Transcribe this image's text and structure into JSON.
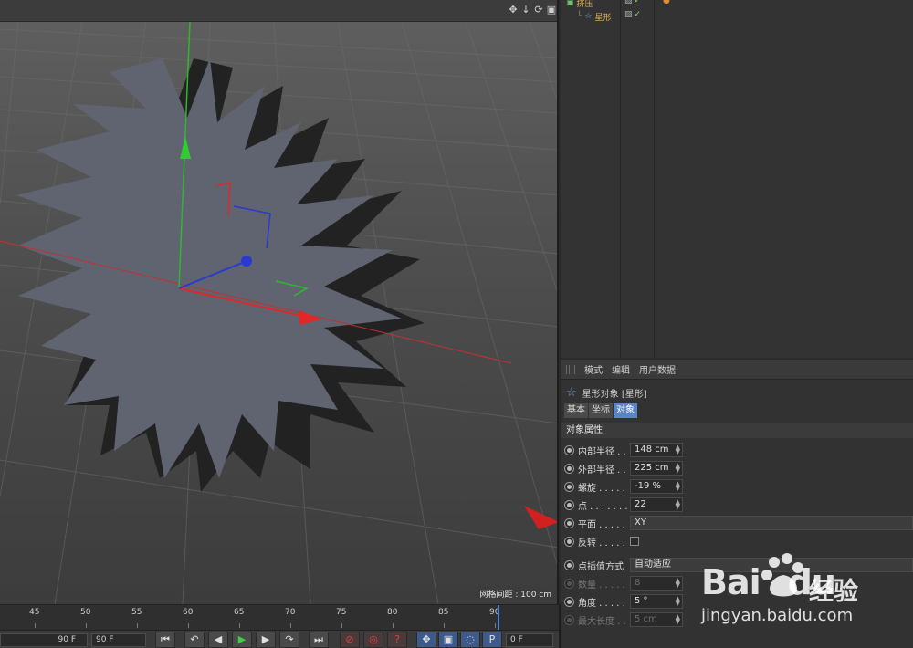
{
  "viewport": {
    "grid_label": "网格间距 : 100 cm",
    "icons": [
      "move-view-icon",
      "down-arrow-icon",
      "rotate-view-icon",
      "maximize-icon"
    ]
  },
  "object_manager": {
    "objects": [
      {
        "name": "挤压",
        "icon": "extrude-icon"
      },
      {
        "name": "星形",
        "icon": "star-icon"
      }
    ]
  },
  "attributes": {
    "menu": [
      "模式",
      "编辑",
      "用户数据"
    ],
    "object_title": "星形对象 [星形]",
    "tabs": [
      "基本",
      "坐标",
      "对象"
    ],
    "section_title": "对象属性",
    "params": [
      {
        "label": "内部半径 . .",
        "value": "148 cm"
      },
      {
        "label": "外部半径 . .",
        "value": "225 cm"
      },
      {
        "label": "螺旋 . . . . .",
        "value": "-19 %"
      },
      {
        "label": "点 . . . . . . .",
        "value": "22"
      },
      {
        "label": "平面 . . . . .",
        "value": "XY"
      },
      {
        "label": "反转 . . . . .",
        "value": ""
      }
    ],
    "interp": [
      {
        "label": "点插值方式",
        "value": "自动适应"
      },
      {
        "label": "数量 . . . . .",
        "value": "8"
      },
      {
        "label": "角度 . . . . .",
        "value": "5 °"
      },
      {
        "label": "最大长度 . .",
        "value": "5 cm"
      }
    ]
  },
  "timeline": {
    "ticks": [
      "45",
      "50",
      "55",
      "60",
      "65",
      "70",
      "75",
      "80",
      "85",
      "90"
    ],
    "start_field": "90 F",
    "end_field": "90 F",
    "frame_field": "0 F"
  },
  "watermark": {
    "logo": "Bai",
    "logo2": "du",
    "text": "经验",
    "url": "jingyan.baidu.com"
  }
}
